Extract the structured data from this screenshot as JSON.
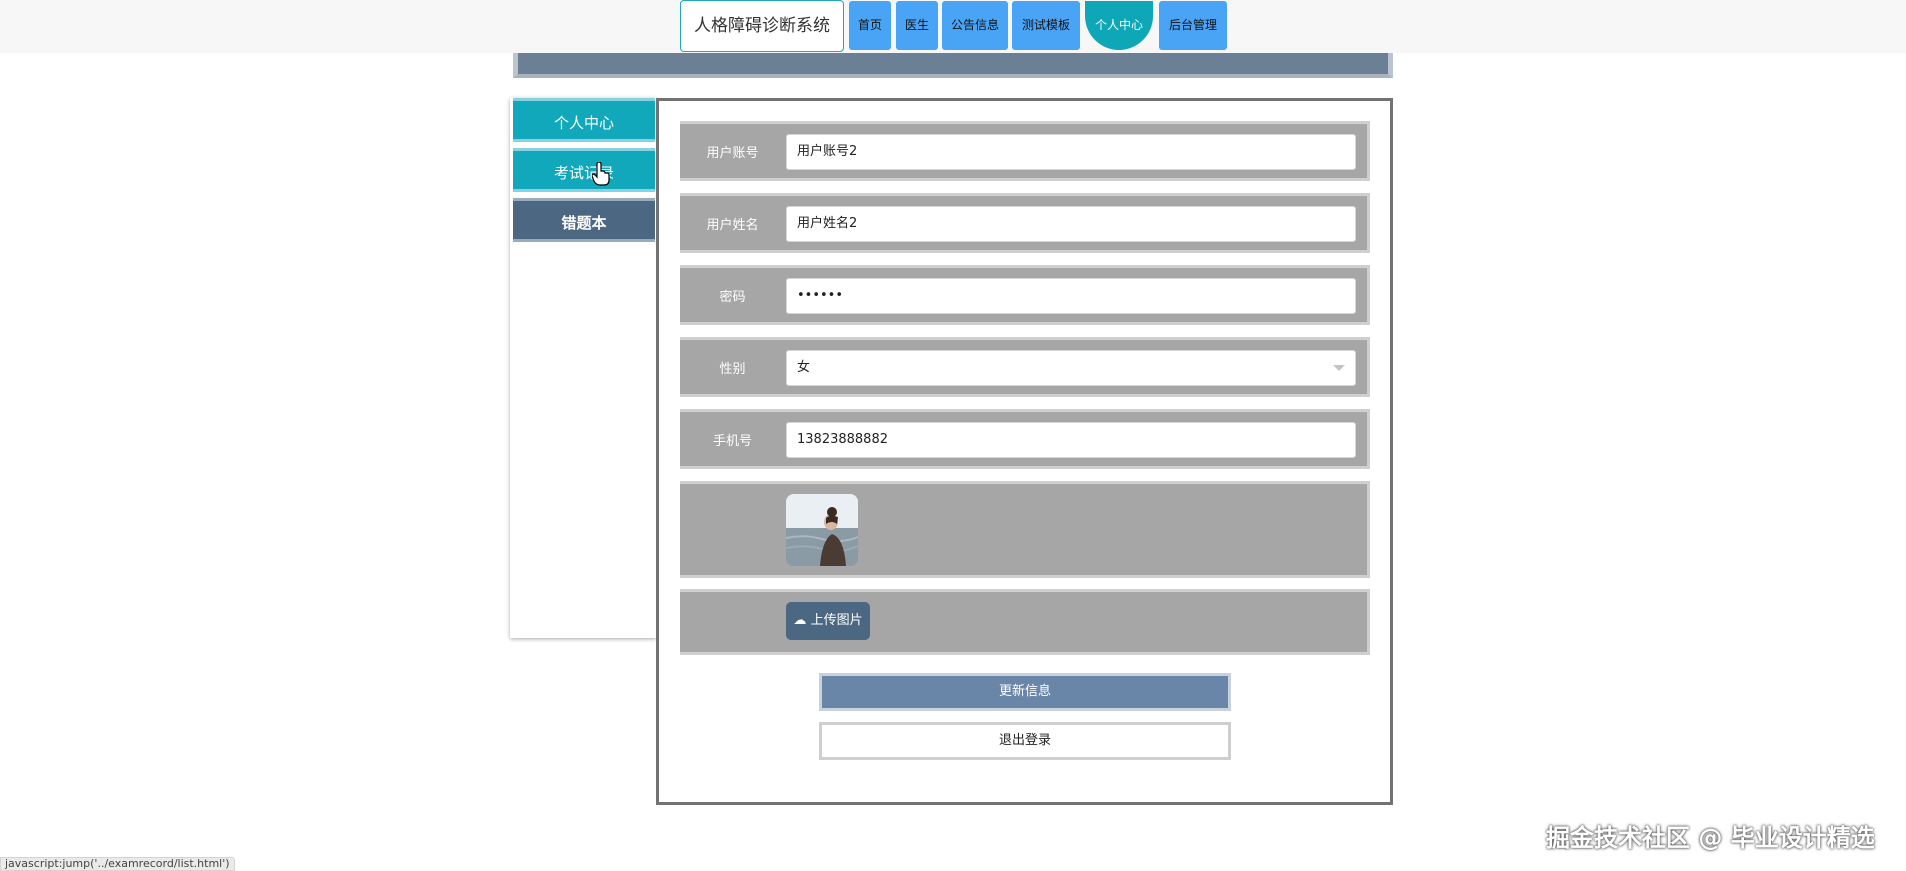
{
  "nav": {
    "brand": "人格障碍诊断系统",
    "items": [
      {
        "label": "首页"
      },
      {
        "label": "医生"
      },
      {
        "label": "公告信息"
      },
      {
        "label": "测试模板"
      },
      {
        "label": "个人中心"
      },
      {
        "label": "后台管理"
      }
    ],
    "active_index": 4
  },
  "sidebar": {
    "items": [
      {
        "label": "个人中心"
      },
      {
        "label": "考试记录"
      },
      {
        "label": "错题本"
      }
    ]
  },
  "form": {
    "account": {
      "label": "用户账号",
      "value": "用户账号2"
    },
    "name": {
      "label": "用户姓名",
      "value": "用户姓名2"
    },
    "password": {
      "label": "密码",
      "value": "••••••"
    },
    "gender": {
      "label": "性别",
      "value": "女"
    },
    "phone": {
      "label": "手机号",
      "value": "13823888882"
    },
    "upload_label": "上传图片",
    "update_label": "更新信息",
    "logout_label": "退出登录"
  },
  "status_bar": "javascript:jump('../examrecord/list.html')",
  "watermark": "掘金技术社区 @ 毕业设计精选",
  "colors": {
    "teal": "#11a8bb",
    "nav_blue": "#4aa4f6",
    "slate": "#4c6782",
    "row_gray": "#a6a6a6"
  }
}
